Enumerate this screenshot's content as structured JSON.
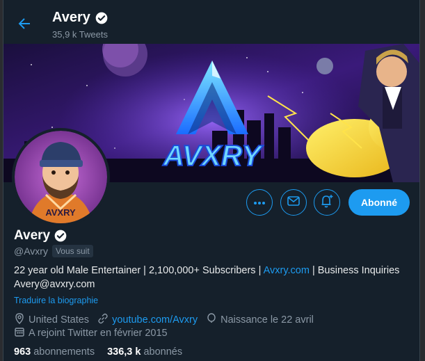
{
  "header": {
    "name": "Avery",
    "tweet_count": "35,9 k Tweets"
  },
  "banner": {
    "logo_text": "AVXRY"
  },
  "avatar": {
    "caption": "AVXRY"
  },
  "actions": {
    "follow_label": "Abonné"
  },
  "profile": {
    "name": "Avery",
    "handle": "@Avxry",
    "follows_you": "Vous suit",
    "bio_part1": "22 year old Male Entertainer | 2,100,000+ Subscribers | ",
    "bio_link": "Avxry.com",
    "bio_part2": " | Business Inquiries Avery@avxry.com",
    "translate": "Traduire la biographie",
    "location": "United States",
    "website": "youtube.com/Avxry",
    "birthday": "Naissance le 22 avril",
    "joined": "A rejoint Twitter en février 2015"
  },
  "stats": {
    "following_count": "963",
    "following_label": "abonnements",
    "followers_count": "336,3 k",
    "followers_label": "abonnés"
  },
  "colors": {
    "accent": "#1d9bf0",
    "background": "#15202b",
    "secondary_text": "#8b98a5"
  }
}
